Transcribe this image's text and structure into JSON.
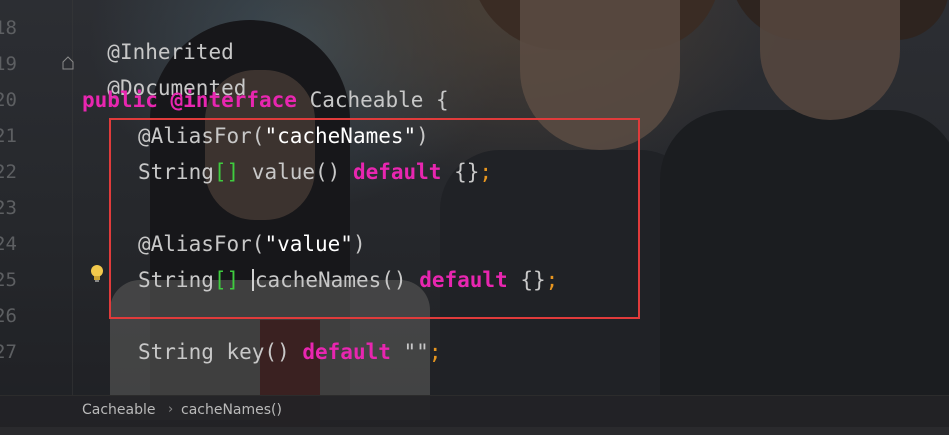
{
  "gutter": {
    "line_numbers": [
      "18",
      "19",
      "20",
      "21",
      "22",
      "23",
      "24",
      "25",
      "26",
      "27"
    ]
  },
  "code": {
    "line_inherited": "@Inherited",
    "line_documented": "@Documented",
    "decl_public": "public",
    "decl_interface": "@interface",
    "decl_name": " Cacheable {",
    "alias1_name": "@AliasFor(",
    "alias1_value": "\"cacheNames\"",
    "alias1_close": ")",
    "value_type": "String",
    "brackets": "[]",
    "value_method": " value() ",
    "default_kw": "default",
    "empty_braces": " {}",
    "semicolon": ";",
    "alias2_name": "@AliasFor(",
    "alias2_value": "\"value\"",
    "alias2_close": ")",
    "cachenames_method": "cacheNames() ",
    "key_type": "String key() ",
    "key_default_value": " \"\""
  },
  "breadcrumb": {
    "items": [
      "Cacheable",
      "cacheNames()"
    ],
    "separator": "›"
  },
  "colors": {
    "keyword": "#e826b0",
    "bracket": "#3fcc3f",
    "semicolon": "#e8961f",
    "highlight_border": "#e03b3b"
  }
}
